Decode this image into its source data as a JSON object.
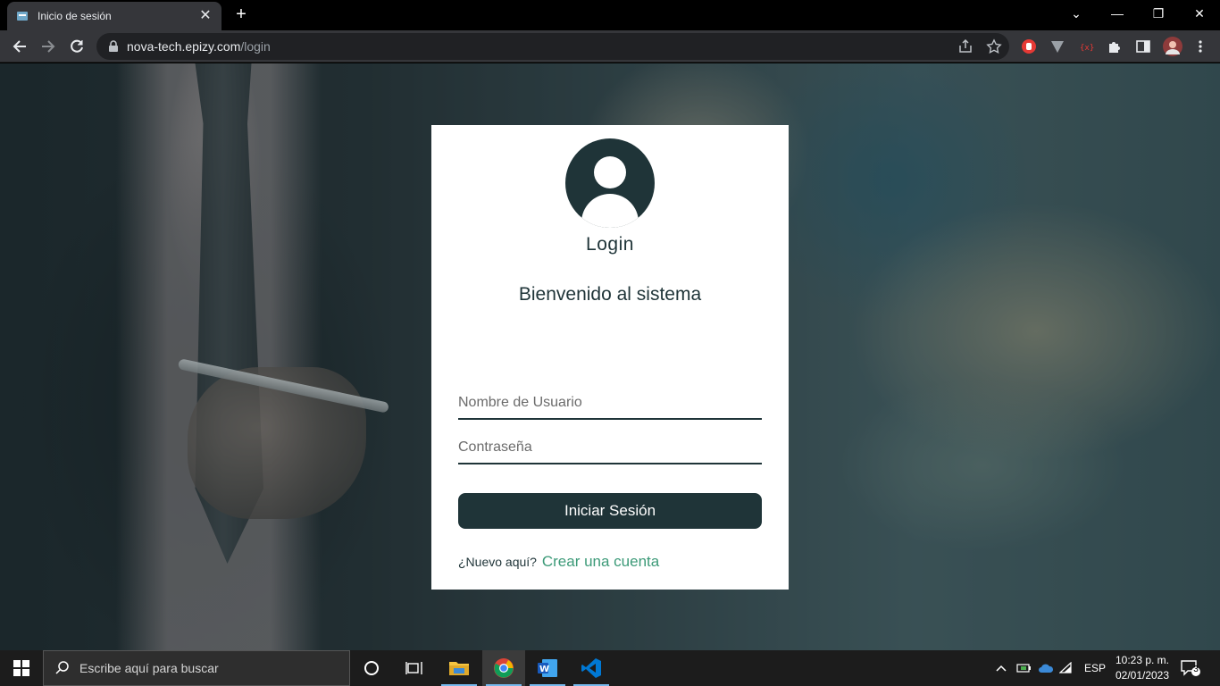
{
  "browser": {
    "tab_title": "Inicio de sesión",
    "tab_close": "✕",
    "new_tab": "+",
    "url_host": "nova-tech.epizy.com",
    "url_path": "/login",
    "window_controls": {
      "dropdown": "⌄",
      "minimize": "—",
      "restore": "❐",
      "close": "✕"
    }
  },
  "login": {
    "title": "Login",
    "welcome": "Bienvenido al sistema",
    "username_placeholder": "Nombre de Usuario",
    "password_placeholder": "Contraseña",
    "submit_label": "Iniciar Sesión",
    "new_here": "¿Nuevo aquí?",
    "create_account": "Crear una cuenta"
  },
  "taskbar": {
    "search_placeholder": "Escribe aquí para buscar",
    "language": "ESP",
    "time": "10:23 p. m.",
    "date": "02/01/2023",
    "notification_count": "3"
  },
  "colors": {
    "primary": "#1f3438",
    "link": "#3c9a78",
    "card_bg": "#ffffff"
  }
}
